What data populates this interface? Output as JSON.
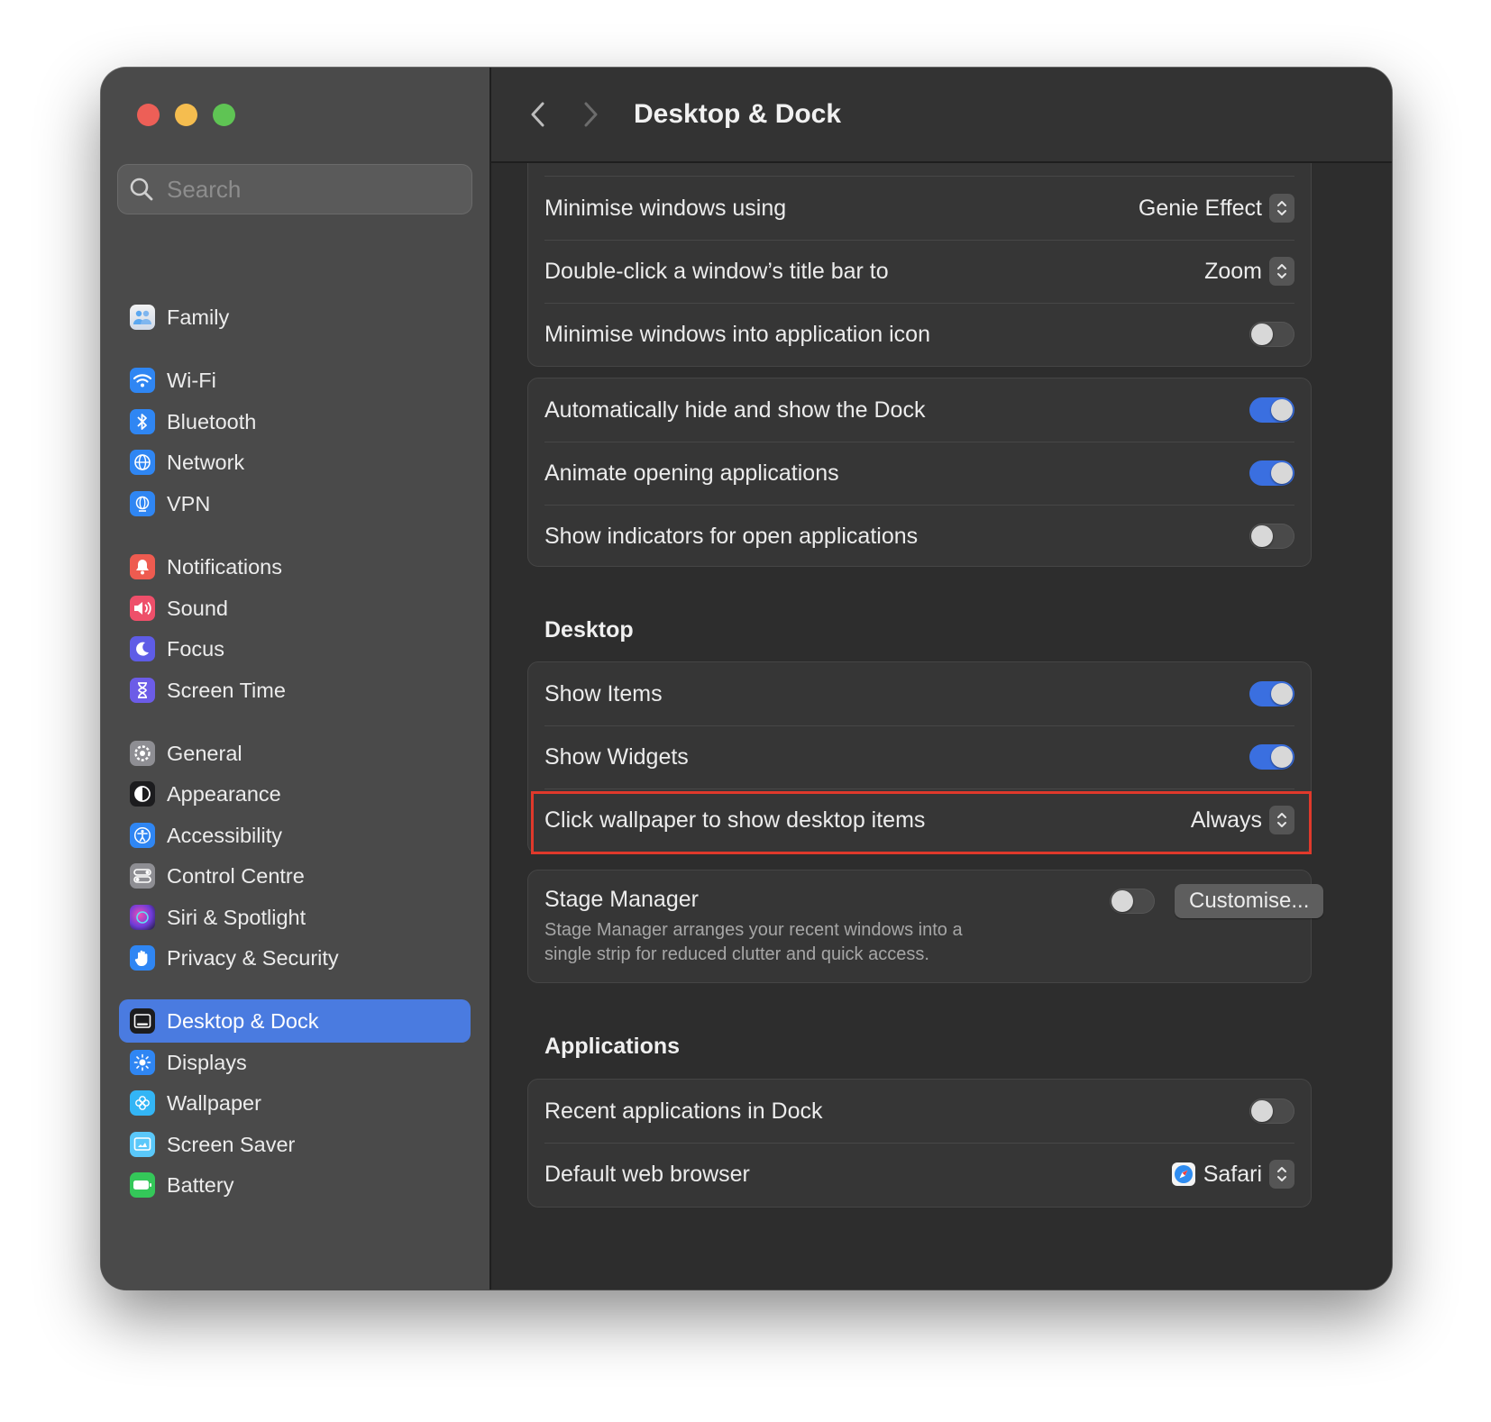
{
  "window": {
    "title": "Desktop & Dock"
  },
  "search": {
    "placeholder": "Search"
  },
  "sidebar": {
    "items": [
      {
        "label": "Family"
      },
      {
        "label": "Wi-Fi"
      },
      {
        "label": "Bluetooth"
      },
      {
        "label": "Network"
      },
      {
        "label": "VPN"
      },
      {
        "label": "Notifications"
      },
      {
        "label": "Sound"
      },
      {
        "label": "Focus"
      },
      {
        "label": "Screen Time"
      },
      {
        "label": "General"
      },
      {
        "label": "Appearance"
      },
      {
        "label": "Accessibility"
      },
      {
        "label": "Control Centre"
      },
      {
        "label": "Siri & Spotlight"
      },
      {
        "label": "Privacy & Security"
      },
      {
        "label": "Desktop & Dock"
      },
      {
        "label": "Displays"
      },
      {
        "label": "Wallpaper"
      },
      {
        "label": "Screen Saver"
      },
      {
        "label": "Battery"
      }
    ],
    "selected": "Desktop & Dock"
  },
  "dock_windows": {
    "minimise_using": {
      "label": "Minimise windows using",
      "value": "Genie Effect"
    },
    "double_click": {
      "label": "Double-click a window’s title bar to",
      "value": "Zoom"
    },
    "minimise_into_icon": {
      "label": "Minimise windows into application icon",
      "on": false
    }
  },
  "dock_behaviour": {
    "auto_hide": {
      "label": "Automatically hide and show the Dock",
      "on": true
    },
    "animate": {
      "label": "Animate opening applications",
      "on": true
    },
    "indicators": {
      "label": "Show indicators for open applications",
      "on": false
    }
  },
  "desktop": {
    "section_title": "Desktop",
    "show_items": {
      "label": "Show Items",
      "on": true
    },
    "show_widgets": {
      "label": "Show Widgets",
      "on": true
    },
    "click_wallpaper": {
      "label": "Click wallpaper to show desktop items",
      "value": "Always"
    }
  },
  "stage_manager": {
    "label": "Stage Manager",
    "description_line1": "Stage Manager arranges your recent windows into a",
    "description_line2": "single strip for reduced clutter and quick access.",
    "on": false,
    "customise_label": "Customise..."
  },
  "applications": {
    "section_title": "Applications",
    "recent_apps": {
      "label": "Recent applications in Dock",
      "on": false
    },
    "default_browser": {
      "label": "Default web browser",
      "value": "Safari"
    }
  },
  "colors": {
    "accent": "#3a6fe0",
    "selection": "#4a7be0",
    "highlight_border": "#e0392b"
  }
}
